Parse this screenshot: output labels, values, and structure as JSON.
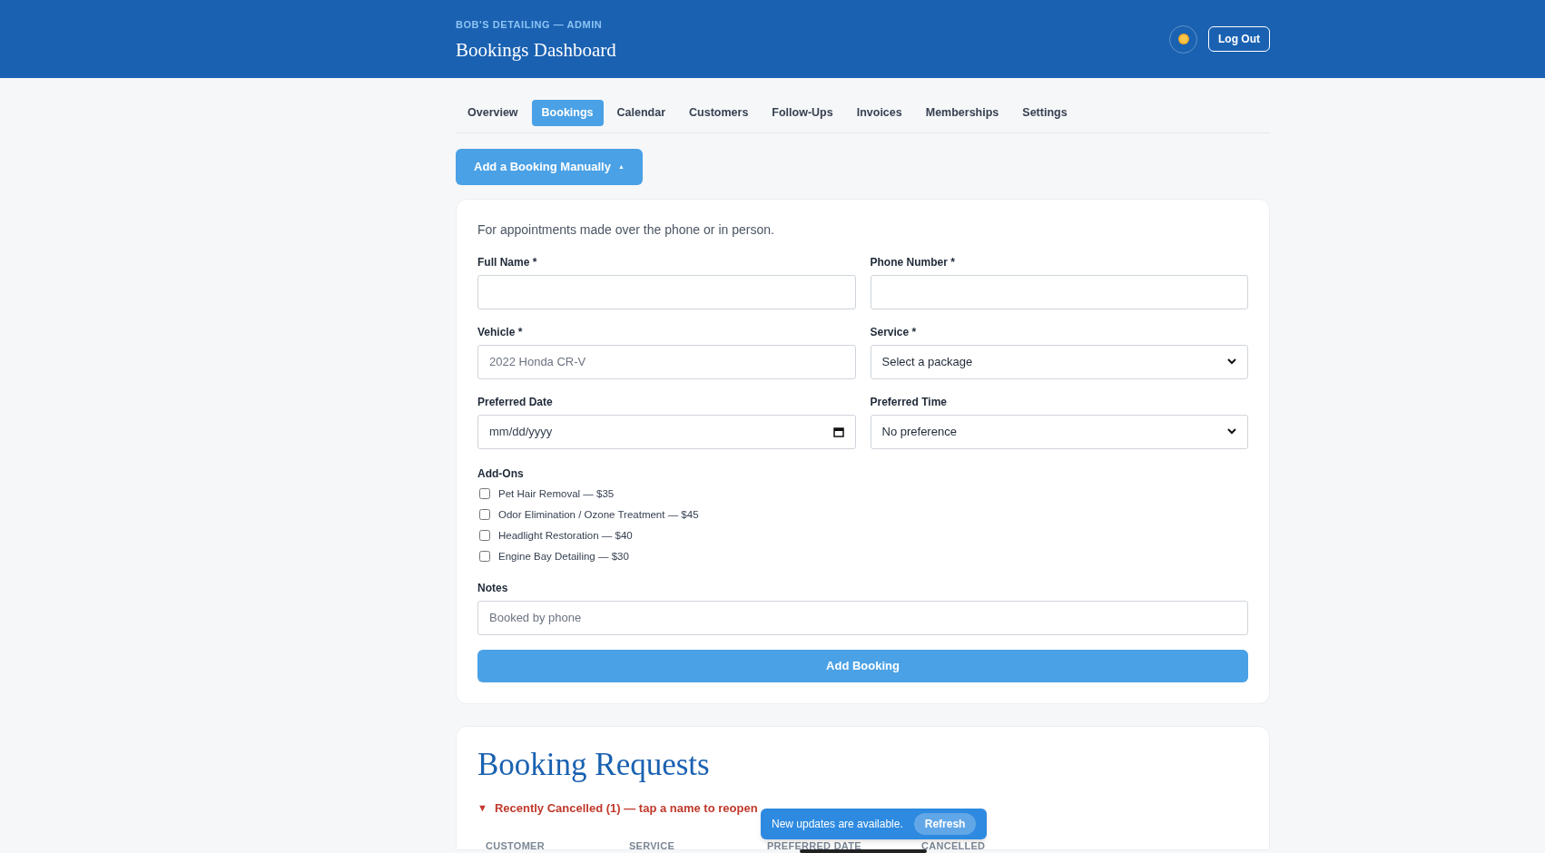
{
  "header": {
    "eyebrow": "BOB'S DETAILING — ADMIN",
    "title": "Bookings Dashboard",
    "logout": "Log Out"
  },
  "tabs": [
    {
      "label": "Overview",
      "selected": false
    },
    {
      "label": "Bookings",
      "selected": true
    },
    {
      "label": "Calendar",
      "selected": false
    },
    {
      "label": "Customers",
      "selected": false
    },
    {
      "label": "Follow-Ups",
      "selected": false
    },
    {
      "label": "Invoices",
      "selected": false
    },
    {
      "label": "Memberships",
      "selected": false
    },
    {
      "label": "Settings",
      "selected": false
    }
  ],
  "add_toggle": {
    "label": "Add a Booking Manually",
    "caret": "▲",
    "expanded": true
  },
  "form": {
    "intro": "For appointments made over the phone or in person.",
    "fields": [
      {
        "label": "Full Name *",
        "kind": "text"
      },
      {
        "label": "Phone Number *",
        "kind": "text"
      },
      {
        "label": "Vehicle *",
        "kind": "text",
        "placeholder": "2022 Honda CR-V"
      },
      {
        "label": "Service *",
        "kind": "select",
        "value": "Select a package"
      },
      {
        "label": "Preferred Date",
        "kind": "date",
        "placeholder": "mm/dd/yyyy"
      },
      {
        "label": "Preferred Time",
        "kind": "select",
        "value": "No preference"
      }
    ],
    "addons_label": "Add-Ons",
    "addons": [
      {
        "label": "Pet Hair Removal — $35",
        "checked": false
      },
      {
        "label": "Odor Elimination / Ozone Treatment — $45",
        "checked": false
      },
      {
        "label": "Headlight Restoration — $40",
        "checked": false
      },
      {
        "label": "Engine Bay Detailing — $30",
        "checked": false
      }
    ],
    "notes": {
      "label": "Notes",
      "placeholder": "Booked by phone"
    },
    "submit": "Add Booking"
  },
  "requests": {
    "title": "Booking Requests",
    "cancelled_toggle": {
      "marker": "▼",
      "label": "Recently Cancelled (1) — tap a name to reopen",
      "expanded": true
    },
    "columns": [
      "CUSTOMER",
      "SERVICE",
      "PREFERRED DATE",
      "CANCELLED"
    ]
  },
  "toast": {
    "message": "New updates are available.",
    "action": "Refresh"
  }
}
